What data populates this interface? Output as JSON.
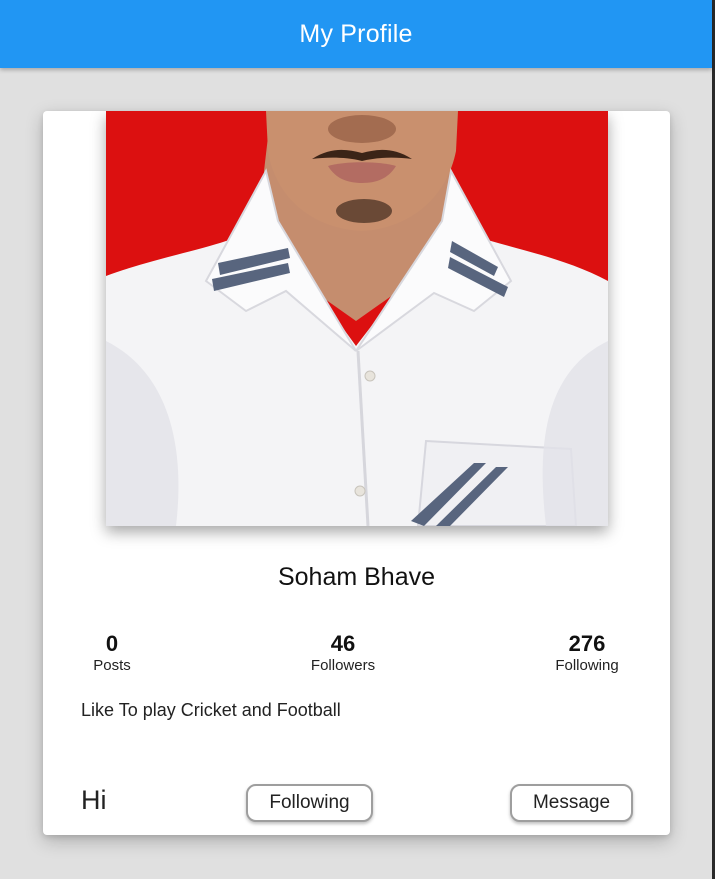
{
  "app_bar": {
    "title": "My Profile",
    "color": "#2196f3"
  },
  "profile": {
    "photo_icon": "profile-photo",
    "name": "Soham Bhave",
    "bio": "Like To play Cricket and Football",
    "greeting": "Hi"
  },
  "stats": {
    "posts": {
      "value": "0",
      "label": "Posts"
    },
    "followers": {
      "value": "46",
      "label": "Followers"
    },
    "following": {
      "value": "276",
      "label": "Following"
    }
  },
  "actions": {
    "following_label": "Following",
    "message_label": "Message"
  }
}
